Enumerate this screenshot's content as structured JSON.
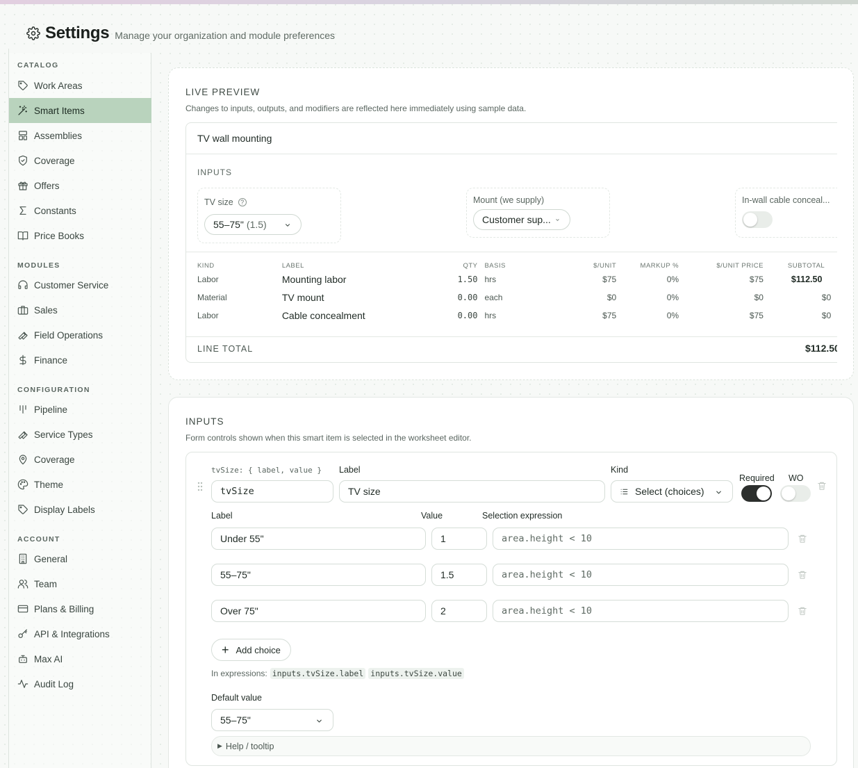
{
  "header": {
    "title": "Settings",
    "subtitle": "Manage your organization and module preferences"
  },
  "sidebar": {
    "sections": [
      {
        "title": "CATALOG",
        "items": [
          {
            "label": "Work Areas",
            "icon": "tag-icon"
          },
          {
            "label": "Smart Items",
            "icon": "magic-wand-icon",
            "active": true
          },
          {
            "label": "Assemblies",
            "icon": "layout-icon"
          },
          {
            "label": "Coverage",
            "icon": "shield-check-icon"
          },
          {
            "label": "Offers",
            "icon": "gift-icon"
          },
          {
            "label": "Constants",
            "icon": "sigma-icon"
          },
          {
            "label": "Price Books",
            "icon": "book-open-icon"
          }
        ]
      },
      {
        "title": "MODULES",
        "items": [
          {
            "label": "Customer Service",
            "icon": "headset-icon"
          },
          {
            "label": "Sales",
            "icon": "briefcase-icon"
          },
          {
            "label": "Field Operations",
            "icon": "wrench-icon"
          },
          {
            "label": "Finance",
            "icon": "dollar-icon"
          }
        ]
      },
      {
        "title": "CONFIGURATION",
        "items": [
          {
            "label": "Pipeline",
            "icon": "kanban-icon"
          },
          {
            "label": "Service Types",
            "icon": "wrench-icon"
          },
          {
            "label": "Coverage",
            "icon": "map-pin-icon"
          },
          {
            "label": "Theme",
            "icon": "palette-icon"
          },
          {
            "label": "Display Labels",
            "icon": "tag-icon"
          }
        ]
      },
      {
        "title": "ACCOUNT",
        "items": [
          {
            "label": "General",
            "icon": "building-icon"
          },
          {
            "label": "Team",
            "icon": "users-icon"
          },
          {
            "label": "Plans & Billing",
            "icon": "credit-card-icon"
          },
          {
            "label": "API & Integrations",
            "icon": "key-icon"
          },
          {
            "label": "Max AI",
            "icon": "bot-icon"
          },
          {
            "label": "Audit Log",
            "icon": "activity-icon"
          }
        ]
      }
    ]
  },
  "preview": {
    "title": "LIVE PREVIEW",
    "description": "Changes to inputs, outputs, and modifiers are reflected here immediately using sample data.",
    "item_name": "TV wall mounting",
    "inputs_label": "INPUTS",
    "inputs": {
      "tv_size": {
        "label": "TV size",
        "value": "55–75\"",
        "value_suffix": "(1.5)"
      },
      "mount": {
        "label": "Mount (we supply)",
        "value": "Customer sup..."
      },
      "cable": {
        "label": "In-wall cable conceal...",
        "toggled": false
      }
    },
    "table": {
      "columns": [
        "KIND",
        "LABEL",
        "QTY",
        "BASIS",
        "$/UNIT",
        "MARKUP %",
        "$/UNIT PRICE",
        "SUBTOTAL"
      ],
      "rows": [
        [
          "Labor",
          "Mounting labor",
          "1.50",
          "hrs",
          "$75",
          "0%",
          "$75",
          "$112.50"
        ],
        [
          "Material",
          "TV mount",
          "0.00",
          "each",
          "$0",
          "0%",
          "$0",
          "$0"
        ],
        [
          "Labor",
          "Cable concealment",
          "0.00",
          "hrs",
          "$75",
          "0%",
          "$75",
          "$0"
        ]
      ]
    },
    "total_label": "LINE TOTAL",
    "total_value": "$112.50"
  },
  "inputs_section": {
    "title": "INPUTS",
    "description": "Form controls shown when this smart item is selected in the worksheet editor.",
    "input": {
      "key_hint": "tvSize: { label, value }",
      "key": "tvSize",
      "label_header": "Label",
      "label": "TV size",
      "kind_header": "Kind",
      "kind": "Select (choices)",
      "required_label": "Required",
      "required": true,
      "wo_label": "WO",
      "wo": false,
      "choices_headers": {
        "label": "Label",
        "value": "Value",
        "expr": "Selection expression"
      },
      "choices": [
        {
          "label": "Under 55\"",
          "value": "1",
          "expr": "area.height < 10"
        },
        {
          "label": "55–75\"",
          "value": "1.5",
          "expr": "area.height < 10"
        },
        {
          "label": "Over 75\"",
          "value": "2",
          "expr": "area.height < 10"
        }
      ],
      "add_choice": "Add choice",
      "expr_prefix": "In expressions:",
      "expr_refs": [
        "inputs.tvSize.label",
        "inputs.tvSize.value"
      ],
      "default_label": "Default value",
      "default_value": "55–75\"",
      "help_label": "Help / tooltip"
    }
  },
  "colors": {
    "active_nav": "#b9d3bd",
    "toggle_on": "#2c2f2d"
  }
}
